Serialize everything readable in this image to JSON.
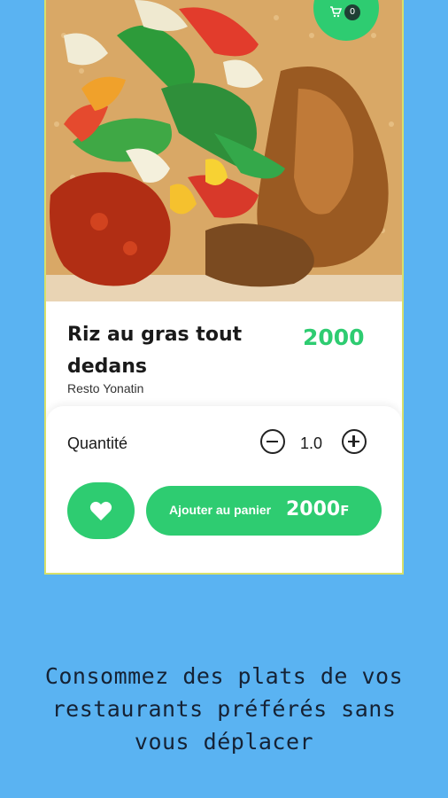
{
  "header": {
    "cart_badge_count": "0",
    "cart_icon": "cart-icon"
  },
  "product": {
    "title": "Riz au gras tout dedans",
    "restaurant": "Resto Yonatin",
    "price": "2000"
  },
  "order": {
    "quantity_label": "Quantité",
    "quantity_value": "1.0",
    "add_to_cart_label": "Ajouter au panier",
    "add_to_cart_price": "2000",
    "currency": "F"
  },
  "promo": {
    "tagline_lines": [
      "Consommez des plats de vos",
      "restaurants préférés sans",
      "vous déplacer"
    ]
  },
  "colors": {
    "accent": "#2ecc71",
    "background": "#5ab3f2",
    "text_dark": "#152235"
  }
}
